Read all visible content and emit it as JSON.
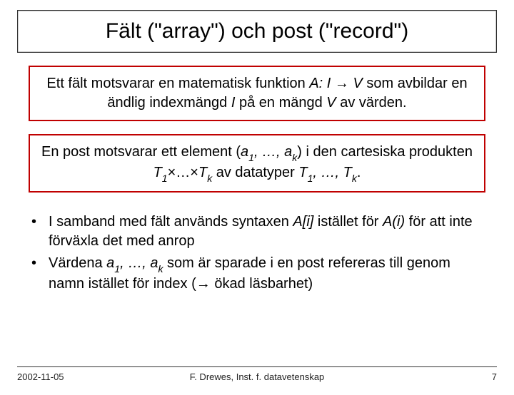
{
  "title": "Fält (\"array\") och post (\"record\")",
  "box1": {
    "pre": "Ett fält motsvarar en matematisk funktion ",
    "fn": "A: I ",
    "arrow": "→",
    "fn2": " V",
    "post": " som avbildar en ändlig indexmängd ",
    "I": "I",
    "mid": " på en mängd ",
    "V": "V",
    "end": " av värden."
  },
  "box2": {
    "pre": "En post motsvarar ett element (",
    "a": "a",
    "one": "1",
    "comma": ", …, ",
    "k": "k",
    "mid": ") i den cartesiska produkten ",
    "T": "T",
    "x": "×",
    "dots": "…",
    "post": " av datatyper ",
    "end": "."
  },
  "bullet1": {
    "t1": "I samband med fält används syntaxen ",
    "Ai": "A[i]",
    "t2": " istället för ",
    "Ai2": "A(i)",
    "t3": " för att inte förväxla det med anrop"
  },
  "bullet2": {
    "t1": "Värdena ",
    "a": "a",
    "one": "1",
    "comma": ", …, ",
    "k": "k",
    "t2": " som är sparade i en post refereras till genom namn istället för index (",
    "arrow": "→",
    "t3": " ökad läsbarhet)"
  },
  "footer": {
    "date": "2002-11-05",
    "center": "F. Drewes, Inst. f. datavetenskap",
    "page": "7"
  }
}
